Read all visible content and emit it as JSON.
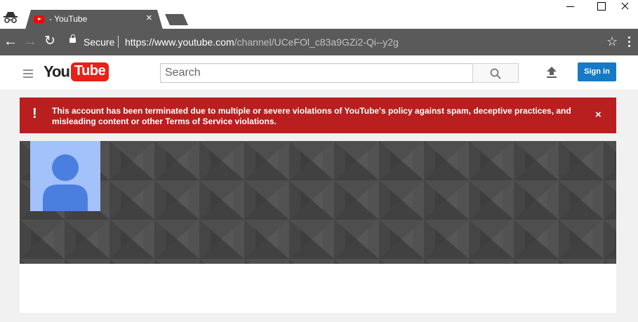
{
  "browser": {
    "tab_title": "- YouTube",
    "tab_close": "×",
    "secure_label": "Secure",
    "url_host": "https://www.youtube.com",
    "url_path": "/channel/UCeFOl_c83a9GZi2-Qi--y2g",
    "icons": {
      "incognito": "incognito-icon",
      "back": "back-arrow-icon",
      "forward": "forward-arrow-icon",
      "reload": "reload-icon",
      "lock": "lock-icon",
      "star": "bookmark-star-icon",
      "menu": "more-vert-icon"
    }
  },
  "header": {
    "logo_you": "You",
    "logo_tube": "Tube",
    "search_placeholder": "Search",
    "signin_label": "Sign in",
    "colors": {
      "brand_red": "#e62117",
      "signin_blue": "#167ac6"
    }
  },
  "alert": {
    "icon": "!",
    "message": "This account has been terminated due to multiple or severe violations of YouTube's policy against spam, deceptive practices, and misleading content or other Terms of Service violations.",
    "close": "×",
    "color": "#b91f1f"
  },
  "channel": {
    "avatar_color": "#a3c1fb",
    "avatar_figure_color": "#4a7fe0",
    "banner_color": "#494949"
  }
}
